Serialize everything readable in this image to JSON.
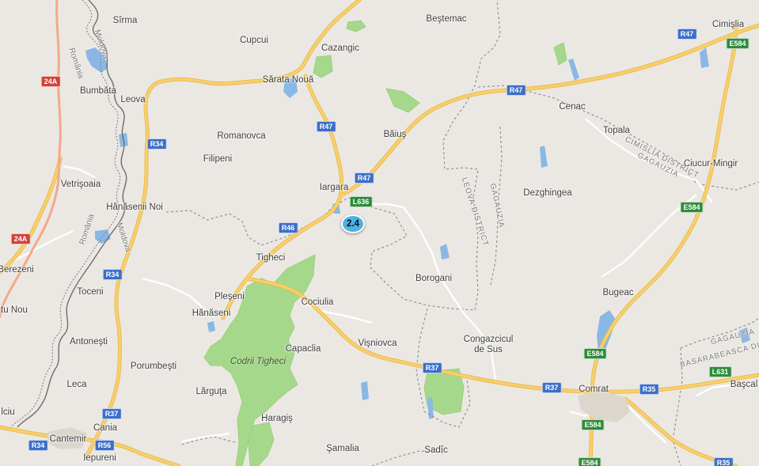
{
  "colors": {
    "land": "#ebe8e3",
    "forest": "#a6d88c",
    "water": "#8ab8e6",
    "highway": "#f7cf6b",
    "highway_casing": "#e7b84a",
    "minor_road": "#ffffff",
    "border": "#5f5f5f",
    "marker": "#4db1e4",
    "route_badge_r": "#3b6fc8",
    "route_badge_e": "#2e8b3a",
    "route_badge_n": "#d04238"
  },
  "marker": {
    "label": "2.4",
    "icon": "cluster-marker-icon"
  },
  "places": [
    {
      "id": "sirma",
      "name": "Sîrma"
    },
    {
      "id": "cupcui",
      "name": "Cupcui"
    },
    {
      "id": "cazangic",
      "name": "Cazangic"
    },
    {
      "id": "bestemac",
      "name": "Beştemac"
    },
    {
      "id": "cimislia",
      "name": "Cimişlia"
    },
    {
      "id": "bumbata",
      "name": "Bumbăta"
    },
    {
      "id": "leova",
      "name": "Leova"
    },
    {
      "id": "sarata-noua",
      "name": "Sărata Nouă"
    },
    {
      "id": "romanovca",
      "name": "Romanovca"
    },
    {
      "id": "baius",
      "name": "Băiuş"
    },
    {
      "id": "cenac",
      "name": "Cenac"
    },
    {
      "id": "topala",
      "name": "Topala"
    },
    {
      "id": "filipeni",
      "name": "Filipeni"
    },
    {
      "id": "ciucur-mingir",
      "name": "Ciucur-Mingir"
    },
    {
      "id": "vetrisoaia",
      "name": "Vetrişoaia"
    },
    {
      "id": "iargara",
      "name": "Iargara"
    },
    {
      "id": "dezghingea",
      "name": "Dezghingea"
    },
    {
      "id": "hanasenii-noi",
      "name": "Hănăsenii Noi"
    },
    {
      "id": "tigheci",
      "name": "Tigheci"
    },
    {
      "id": "berezeni",
      "name": "Berezeni"
    },
    {
      "id": "borogani",
      "name": "Borogani"
    },
    {
      "id": "bugeac",
      "name": "Bugeac"
    },
    {
      "id": "pleseni",
      "name": "Pleşeni"
    },
    {
      "id": "toceni",
      "name": "Toceni"
    },
    {
      "id": "cociulia",
      "name": "Cociulia"
    },
    {
      "id": "tu-nou",
      "name": "tu Nou"
    },
    {
      "id": "hanaseni",
      "name": "Hănăseni"
    },
    {
      "id": "antonesti",
      "name": "Antoneşti"
    },
    {
      "id": "capaclia",
      "name": "Capaclia"
    },
    {
      "id": "visniovca",
      "name": "Vişniovca"
    },
    {
      "id": "congazcicul",
      "name": "Congazcicul\nde Sus"
    },
    {
      "id": "porumbesti",
      "name": "Porumbeşti"
    },
    {
      "id": "leca",
      "name": "Leca"
    },
    {
      "id": "larguta",
      "name": "Lărguţa"
    },
    {
      "id": "comrat",
      "name": "Comrat"
    },
    {
      "id": "bascal",
      "name": "Başcal"
    },
    {
      "id": "iciu",
      "name": "lciu"
    },
    {
      "id": "cania",
      "name": "Cania"
    },
    {
      "id": "haragis",
      "name": "Haragiş"
    },
    {
      "id": "cantemir",
      "name": "Cantemir"
    },
    {
      "id": "samalia",
      "name": "Şamalia"
    },
    {
      "id": "sadic",
      "name": "Sadîc"
    },
    {
      "id": "iepureni",
      "name": "Iepureni"
    }
  ],
  "forest_labels": [
    {
      "id": "codrii-tigheci",
      "name": "Codrii Tigheci"
    }
  ],
  "country_labels": [
    {
      "id": "romania-north",
      "name": "România"
    },
    {
      "id": "moldova-north",
      "name": "Moldova"
    },
    {
      "id": "romania-south",
      "name": "România"
    },
    {
      "id": "moldova-south",
      "name": "Moldova"
    }
  ],
  "district_labels": [
    {
      "id": "cimislia-gagauzia",
      "name": "CIMISLIA DISTRICT\nGAGAUZIA"
    },
    {
      "id": "leova-district",
      "name": "LEOVA DISTRICT"
    },
    {
      "id": "gagauzia-vertical",
      "name": "GAGAUZIA"
    },
    {
      "id": "gagauzia-se",
      "name": "GAGAUZIA"
    },
    {
      "id": "basarabeasca",
      "name": "BASARABEASCA DI"
    }
  ],
  "route_badges": [
    {
      "id": "r47-top",
      "label": "R47",
      "kind": "r"
    },
    {
      "id": "e584-top",
      "label": "E584",
      "kind": "e"
    },
    {
      "id": "24a-top",
      "label": "24A",
      "kind": "n"
    },
    {
      "id": "r47-mid",
      "label": "R47",
      "kind": "r"
    },
    {
      "id": "r47-baius",
      "label": "R47",
      "kind": "r"
    },
    {
      "id": "r34-top",
      "label": "R34",
      "kind": "r"
    },
    {
      "id": "r47-iargara",
      "label": "R47",
      "kind": "r"
    },
    {
      "id": "l636",
      "label": "L636",
      "kind": "e"
    },
    {
      "id": "e584-mid",
      "label": "E584",
      "kind": "e"
    },
    {
      "id": "r46",
      "label": "R46",
      "kind": "r"
    },
    {
      "id": "24a-bottom",
      "label": "24A",
      "kind": "n"
    },
    {
      "id": "r34-mid",
      "label": "R34",
      "kind": "r"
    },
    {
      "id": "e584-bugeac",
      "label": "E584",
      "kind": "e"
    },
    {
      "id": "r37-east",
      "label": "R37",
      "kind": "r"
    },
    {
      "id": "l631",
      "label": "L631",
      "kind": "e"
    },
    {
      "id": "r37-comrat",
      "label": "R37",
      "kind": "r"
    },
    {
      "id": "r35",
      "label": "R35",
      "kind": "r"
    },
    {
      "id": "r37-west",
      "label": "R37",
      "kind": "r"
    },
    {
      "id": "e584-comrat",
      "label": "E584",
      "kind": "e"
    },
    {
      "id": "r34-bottom",
      "label": "R34",
      "kind": "r"
    },
    {
      "id": "r56",
      "label": "R56",
      "kind": "r"
    },
    {
      "id": "e584-bottom",
      "label": "E584",
      "kind": "e"
    },
    {
      "id": "r35-bottom",
      "label": "R35",
      "kind": "r"
    }
  ]
}
